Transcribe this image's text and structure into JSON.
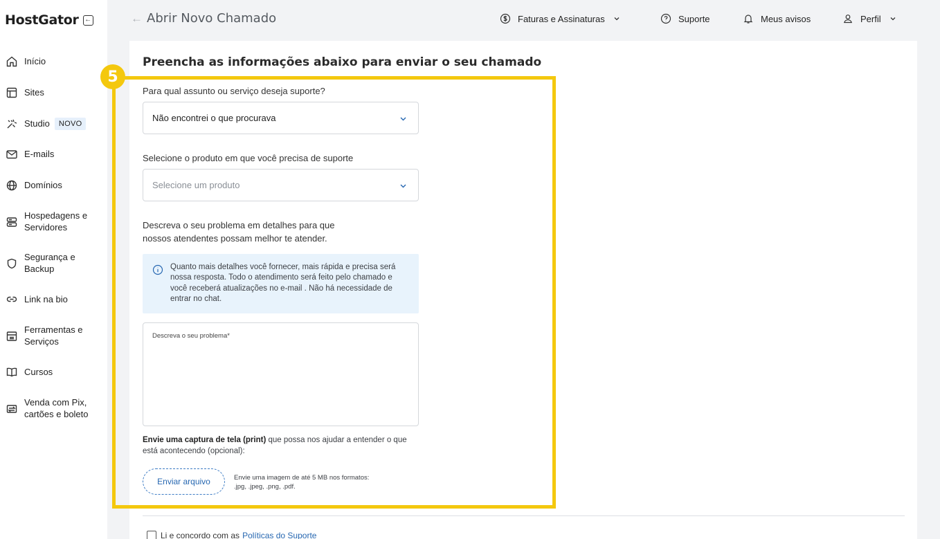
{
  "brand": {
    "name": "HostGator"
  },
  "sidebar": {
    "items": [
      {
        "label": "Início",
        "icon": "home-icon"
      },
      {
        "label": "Sites",
        "icon": "layout-icon"
      },
      {
        "label": "Studio",
        "icon": "studio-icon",
        "badge": "NOVO"
      },
      {
        "label": "E-mails",
        "icon": "mail-icon"
      },
      {
        "label": "Domínios",
        "icon": "globe-icon"
      },
      {
        "label": "Hospedagens e Servidores",
        "line1": "Hospedagens e",
        "line2": "Servidores",
        "icon": "server-icon"
      },
      {
        "label": "Segurança e Backup",
        "line1": "Segurança e",
        "line2": "Backup",
        "icon": "shield-icon"
      },
      {
        "label": "Link na bio",
        "icon": "link-icon"
      },
      {
        "label": "Ferramentas e Serviços",
        "line1": "Ferramentas e",
        "line2": "Serviços",
        "icon": "tools-icon"
      },
      {
        "label": "Cursos",
        "icon": "book-icon"
      },
      {
        "label": "Venda com Pix, cartões e boleto",
        "line1": "Venda com Pix,",
        "line2": "cartões e boleto",
        "icon": "exchange-icon"
      }
    ]
  },
  "header": {
    "title": "Abrir Novo Chamado",
    "menu": [
      {
        "label": "Faturas e Assinaturas",
        "icon": "dollar-circle-icon",
        "dropdown": true
      },
      {
        "label": "Suporte",
        "icon": "help-circle-icon",
        "dropdown": false
      },
      {
        "label": "Meus avisos",
        "icon": "bell-icon",
        "dropdown": false
      },
      {
        "label": "Perfil",
        "icon": "user-icon",
        "dropdown": true
      }
    ]
  },
  "form": {
    "heading": "Preencha as informações abaixo para enviar o seu chamado",
    "subject_label": "Para qual assunto ou serviço deseja suporte?",
    "subject_value": "Não encontrei o que procurava",
    "product_label": "Selecione o produto em que você precisa de suporte",
    "product_placeholder": "Selecione um produto",
    "describe_line1": "Descreva o seu problema em detalhes para que",
    "describe_line2": "nossos atendentes possam melhor te atender.",
    "info_text": "Quanto mais detalhes você fornecer, mais rápida e precisa será nossa resposta. Todo o atendimento será feito pelo chamado e você receberá atualizações no e-mail . Não há necessidade de entrar no chat.",
    "textarea_placeholder": "Descreva o seu problema*",
    "print_bold": "Envie uma captura de tela (print)",
    "print_rest": " que possa nos ajudar a entender o que está acontecendo (opcional):",
    "upload_button": "Enviar arquivo",
    "upload_note_line1": "Envie uma imagem de até 5 MB nos formatos:",
    "upload_note_line2": ".jpg, .jpeg, .png, .pdf.",
    "agree_text": "Li e concordo com as",
    "agree_link": "Políticas do Suporte"
  },
  "step": {
    "number": "5"
  },
  "colors": {
    "highlight": "#f4c80e",
    "link": "#2667b1",
    "info_bg": "#e8f3fc"
  }
}
